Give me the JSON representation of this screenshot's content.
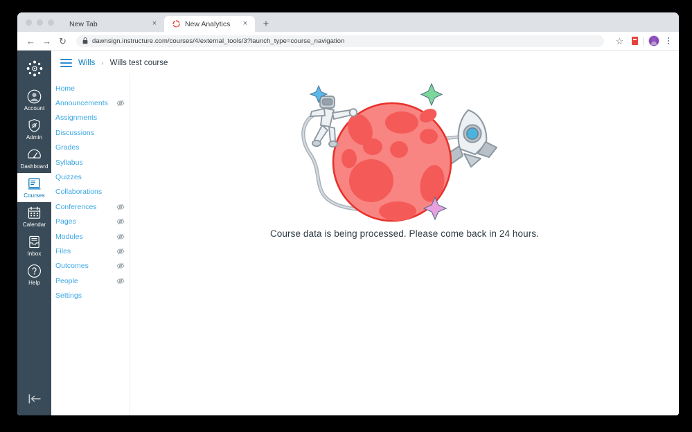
{
  "browser": {
    "tabs": [
      {
        "title": "New Tab",
        "active": false,
        "favicon": "none",
        "close_label": "×"
      },
      {
        "title": "New Analytics",
        "active": true,
        "favicon": "canvas-analytics-spinner-icon",
        "close_label": "×"
      }
    ],
    "new_tab_label": "+",
    "toolbar": {
      "back_label": "←",
      "forward_label": "→",
      "reload_label": "↻",
      "url": "dawnsign.instructure.com/courses/4/external_tools/3?launch_type=course_navigation",
      "lock_icon": "padlock-icon",
      "bookmark_label": "☆",
      "extension_icon": "extension-icon",
      "profile_icon": "user-avatar-icon",
      "menu_label": "⋮"
    }
  },
  "global_nav": {
    "logo": "canvas-logo",
    "items": [
      {
        "label": "Account",
        "icon": "user-circle-icon",
        "active": false
      },
      {
        "label": "Admin",
        "icon": "shield-icon",
        "active": false
      },
      {
        "label": "Dashboard",
        "icon": "speedometer-icon",
        "active": false
      },
      {
        "label": "Courses",
        "icon": "book-icon",
        "active": true
      },
      {
        "label": "Calendar",
        "icon": "calendar-icon",
        "active": false
      },
      {
        "label": "Inbox",
        "icon": "inbox-tray-icon",
        "active": false
      },
      {
        "label": "Help",
        "icon": "question-circle-icon",
        "active": false
      }
    ],
    "collapse_icon": "collapse-left-icon"
  },
  "breadcrumb": {
    "menu_icon": "hamburger-menu-icon",
    "root": "Wills",
    "separator": "›",
    "current": "Wills test course"
  },
  "course_nav": {
    "items": [
      {
        "label": "Home",
        "hidden": false
      },
      {
        "label": "Announcements",
        "hidden": true
      },
      {
        "label": "Assignments",
        "hidden": false
      },
      {
        "label": "Discussions",
        "hidden": false
      },
      {
        "label": "Grades",
        "hidden": false
      },
      {
        "label": "Syllabus",
        "hidden": false
      },
      {
        "label": "Quizzes",
        "hidden": false
      },
      {
        "label": "Collaborations",
        "hidden": false
      },
      {
        "label": "Conferences",
        "hidden": true
      },
      {
        "label": "Pages",
        "hidden": true
      },
      {
        "label": "Modules",
        "hidden": true
      },
      {
        "label": "Files",
        "hidden": true
      },
      {
        "label": "Outcomes",
        "hidden": true
      },
      {
        "label": "People",
        "hidden": true
      },
      {
        "label": "Settings",
        "hidden": false
      }
    ],
    "hidden_icon": "eye-slash-icon"
  },
  "main": {
    "illustration": "space-planet-astronaut-rocket-illustration",
    "message": "Course data is being processed. Please come back in 24 hours."
  },
  "colors": {
    "brand_blue": "#0374B5",
    "link_blue": "#3BA7E3",
    "nav_dark": "#394B58",
    "planet_fill": "#F88582",
    "planet_crater": "#F45B58",
    "planet_outline": "#E8312B",
    "star_blue": "#5BB8E8",
    "star_green": "#7CD89A",
    "star_pink": "#E8A0DE",
    "rocket_gray": "#E3E6E8",
    "rocket_port": "#4BB3E0",
    "text_dark": "#2D3B45"
  }
}
